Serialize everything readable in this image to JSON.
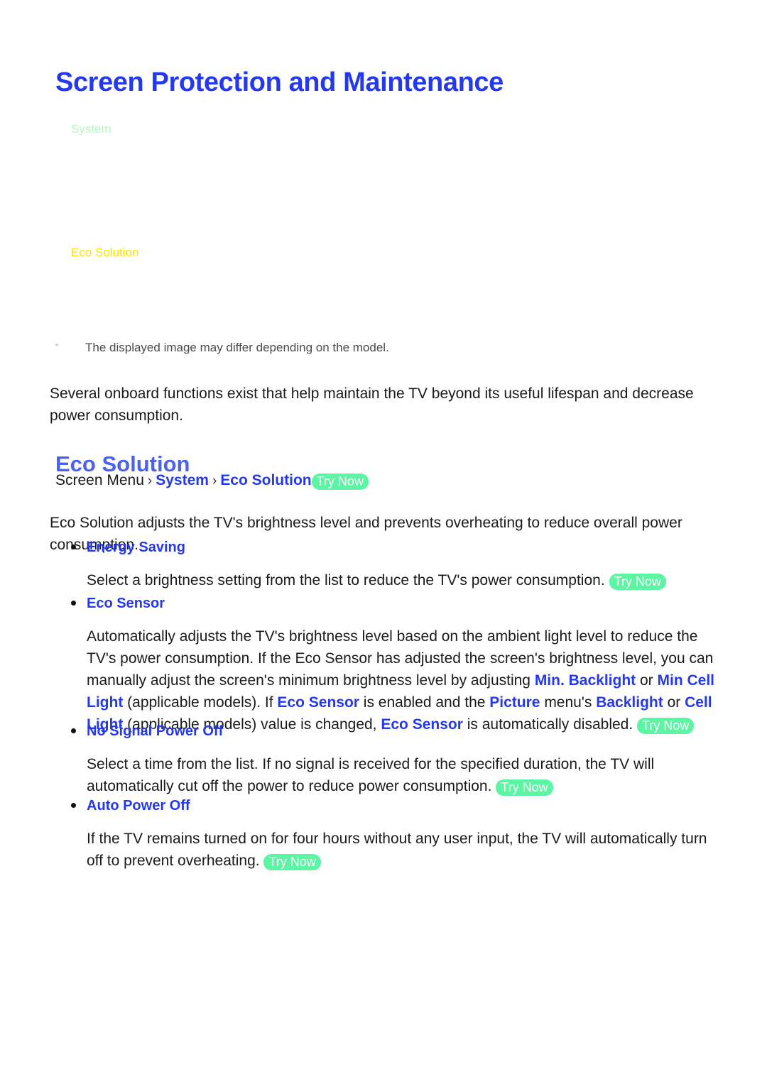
{
  "page": {
    "title": "Screen Protection and Maintenance"
  },
  "menu_figure": {
    "labels": [
      {
        "text": "System",
        "color": "#b9f5c4"
      },
      {
        "text": "Eco Solution",
        "color": "#ffe400"
      }
    ]
  },
  "footnote": {
    "mark": "\"",
    "text": "The displayed image may differ depending on the model."
  },
  "intro": {
    "text": "Several onboard functions exist that help maintain the TV beyond its useful lifespan and decrease power consumption."
  },
  "section": {
    "heading": "Eco Solution",
    "breadcrumb": {
      "root": "Screen Menu",
      "sep": "›",
      "link1": "System",
      "link2": "Eco Solution",
      "badge": "Try Now"
    },
    "description": "Eco Solution adjusts the TV's brightness level and prevents overheating to reduce overall power consumption."
  },
  "bullets": [
    {
      "label": "Energy Saving",
      "body_part1": "Select a brightness setting from the list to reduce the TV's power consumption.",
      "badge": "Try Now"
    },
    {
      "label": "Eco Sensor",
      "body_p1": "Automatically adjusts the TV's brightness level based on the ambient light level to reduce the TV's power consumption. If the Eco Sensor has adjusted the screen's brightness level, you can manually adjust the screen's minimum brightness level by adjusting ",
      "term1": "Min. Backlight",
      "body_p2": " or ",
      "term2": "Min Cell Light",
      "body_p3": " (applicable models). If ",
      "term3": "Eco Sensor",
      "body_p4": " is enabled and the ",
      "term4": "Picture",
      "body_p5": " menu's ",
      "term5": "Backlight",
      "body_p6": " or ",
      "term6": "Cell Light",
      "body_p7": " (applicable models) value is changed, ",
      "term7": "Eco Sensor",
      "body_p8": " is automatically disabled.",
      "badge": "Try Now"
    },
    {
      "label": "No Signal Power Off",
      "body_part1": "Select a time from the list. If no signal is received for the specified duration, the TV will automatically cut off the power to reduce power consumption.",
      "badge": "Try Now"
    },
    {
      "label": "Auto Power Off",
      "body_part1": "If the TV remains turned on for four hours without any user input, the TV will automatically turn off to prevent overheating.",
      "badge": "Try Now"
    }
  ],
  "colors": {
    "accent_blue": "#2438f0",
    "heading_blue": "#4a62ee",
    "badge_green": "#5bf5a4",
    "menu_green": "#b9f5c4",
    "menu_yellow": "#ffe400"
  }
}
